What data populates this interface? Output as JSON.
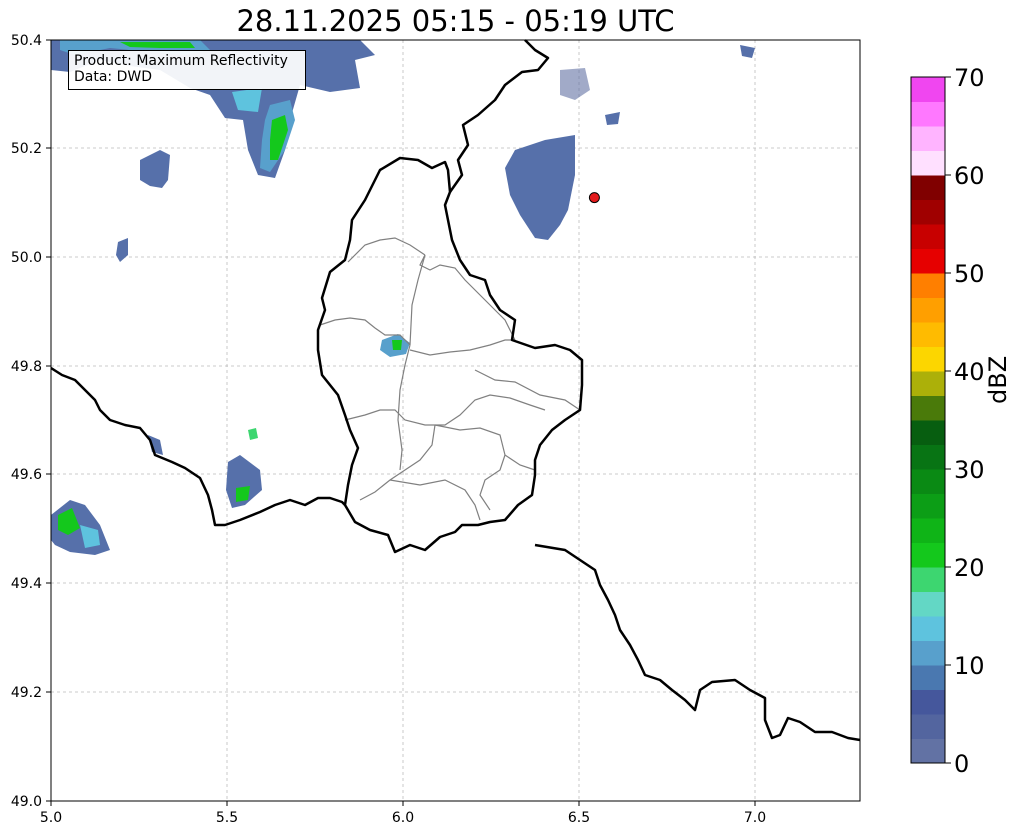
{
  "title": "28.11.2025 05:15 - 05:19 UTC",
  "info_box": {
    "product_line": "Product: Maximum Reflectivity",
    "data_line": "Data: DWD"
  },
  "map": {
    "lon_range": [
      5.0,
      7.3
    ],
    "lat_range": [
      49.0,
      50.4
    ],
    "lon_ticks": [
      "5.0",
      "5.5",
      "6.0",
      "6.5",
      "7.0"
    ],
    "lat_ticks": [
      "49.0",
      "49.2",
      "49.4",
      "49.6",
      "49.8",
      "50.0",
      "50.2",
      "50.4"
    ],
    "grid": true,
    "border_color": "#000000",
    "canton_border_color": "#808080",
    "marker": {
      "lon": 6.545,
      "lat": 50.11,
      "color": "#e31a1c"
    }
  },
  "colorbar": {
    "label": "dBZ",
    "tick_labels": [
      "0",
      "10",
      "20",
      "30",
      "40",
      "50",
      "60",
      "70"
    ],
    "range": [
      0,
      70
    ],
    "levels": [
      {
        "min": 0,
        "color": "#6272a4"
      },
      {
        "min": 2.5,
        "color": "#53659f"
      },
      {
        "min": 5,
        "color": "#45579c"
      },
      {
        "min": 7.5,
        "color": "#4a78b0"
      },
      {
        "min": 10,
        "color": "#58a0cc"
      },
      {
        "min": 12.5,
        "color": "#5ec3de"
      },
      {
        "min": 15,
        "color": "#63d7c5"
      },
      {
        "min": 17.5,
        "color": "#3dd670"
      },
      {
        "min": 20,
        "color": "#14c81c"
      },
      {
        "min": 22.5,
        "color": "#0fb417"
      },
      {
        "min": 25,
        "color": "#0c9e16"
      },
      {
        "min": 27.5,
        "color": "#0a8a14"
      },
      {
        "min": 30,
        "color": "#087414"
      },
      {
        "min": 32.5,
        "color": "#075e10"
      },
      {
        "min": 35,
        "color": "#4a7a0a"
      },
      {
        "min": 37.5,
        "color": "#acb009"
      },
      {
        "min": 40,
        "color": "#fcd600"
      },
      {
        "min": 42.5,
        "color": "#ffbb00"
      },
      {
        "min": 45,
        "color": "#ff9f00"
      },
      {
        "min": 47.5,
        "color": "#ff7f00"
      },
      {
        "min": 50,
        "color": "#e60000"
      },
      {
        "min": 52.5,
        "color": "#c80000"
      },
      {
        "min": 55,
        "color": "#a00000"
      },
      {
        "min": 57.5,
        "color": "#800000"
      },
      {
        "min": 60,
        "color": "#ffe0ff"
      },
      {
        "min": 62.5,
        "color": "#ffb4ff"
      },
      {
        "min": 65,
        "color": "#ff78ff"
      },
      {
        "min": 67.5,
        "color": "#f046f0"
      }
    ]
  }
}
